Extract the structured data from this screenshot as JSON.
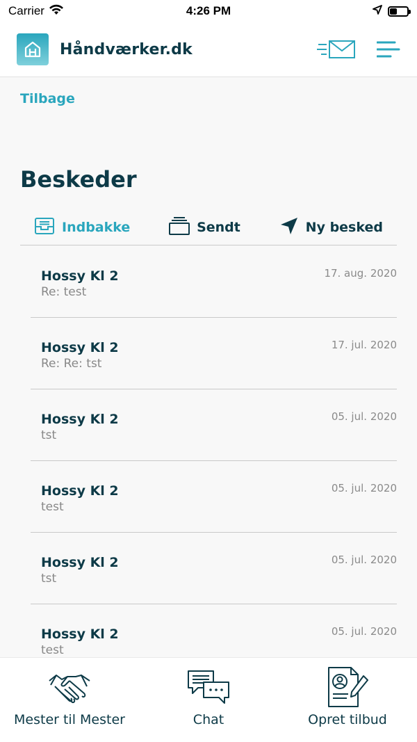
{
  "status_bar": {
    "carrier": "Carrier",
    "time": "4:26 PM"
  },
  "header": {
    "brand": "Håndværker.dk",
    "icons": [
      "house-logo-icon",
      "mail-send-icon",
      "menu-icon"
    ]
  },
  "back_label": "Tilbage",
  "page_title": "Beskeder",
  "tabs": [
    {
      "label": "Indbakke",
      "icon": "inbox-icon",
      "active": true
    },
    {
      "label": "Sendt",
      "icon": "sent-stack-icon",
      "active": false
    },
    {
      "label": "Ny besked",
      "icon": "navigation-arrow-icon",
      "active": false
    }
  ],
  "messages": [
    {
      "sender": "Hossy Kl 2",
      "subject": "Re: test",
      "date": "17. aug. 2020"
    },
    {
      "sender": "Hossy Kl 2",
      "subject": "Re: Re: tst",
      "date": "17. jul. 2020"
    },
    {
      "sender": "Hossy Kl 2",
      "subject": "tst",
      "date": "05. jul. 2020"
    },
    {
      "sender": "Hossy Kl 2",
      "subject": "test",
      "date": "05. jul. 2020"
    },
    {
      "sender": "Hossy Kl 2",
      "subject": "tst",
      "date": "05. jul. 2020"
    },
    {
      "sender": "Hossy Kl 2",
      "subject": "test",
      "date": "05. jul. 2020"
    }
  ],
  "bottom_nav": [
    {
      "label": "Mester til Mester",
      "icon": "handshake-icon"
    },
    {
      "label": "Chat",
      "icon": "chat-bubbles-icon"
    },
    {
      "label": "Opret tilbud",
      "icon": "document-profile-pen-icon"
    }
  ],
  "colors": {
    "accent": "#2aa6bd",
    "dark": "#0d3a47",
    "muted": "#888888"
  }
}
